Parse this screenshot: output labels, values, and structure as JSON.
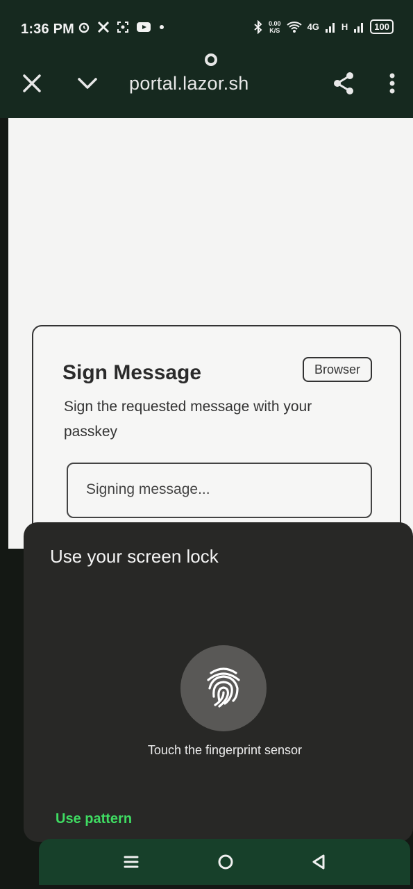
{
  "status_bar": {
    "time": "1:36 PM",
    "left_icons": [
      "alarm-icon",
      "x-app-icon",
      "screenshot-icon",
      "youtube-icon",
      "dot-icon"
    ],
    "net_speed_value": "0.00",
    "net_speed_unit": "K/S",
    "network_4g": "4G",
    "network_h": "H",
    "battery": "100"
  },
  "browser": {
    "url": "portal.lazor.sh",
    "icons": [
      "close-icon",
      "chevron-down-icon",
      "share-icon",
      "more-vert-icon"
    ]
  },
  "card": {
    "title": "Sign Message",
    "badge": "Browser",
    "description": "Sign the requested message with your passkey",
    "status": "Signing message..."
  },
  "auth_sheet": {
    "title": "Use your screen lock",
    "hint": "Touch the fingerprint sensor",
    "alt_action": "Use pattern",
    "accent": "#3fdc62"
  },
  "nav_bar": {
    "icons": [
      "recents-icon",
      "home-icon",
      "back-icon"
    ]
  }
}
